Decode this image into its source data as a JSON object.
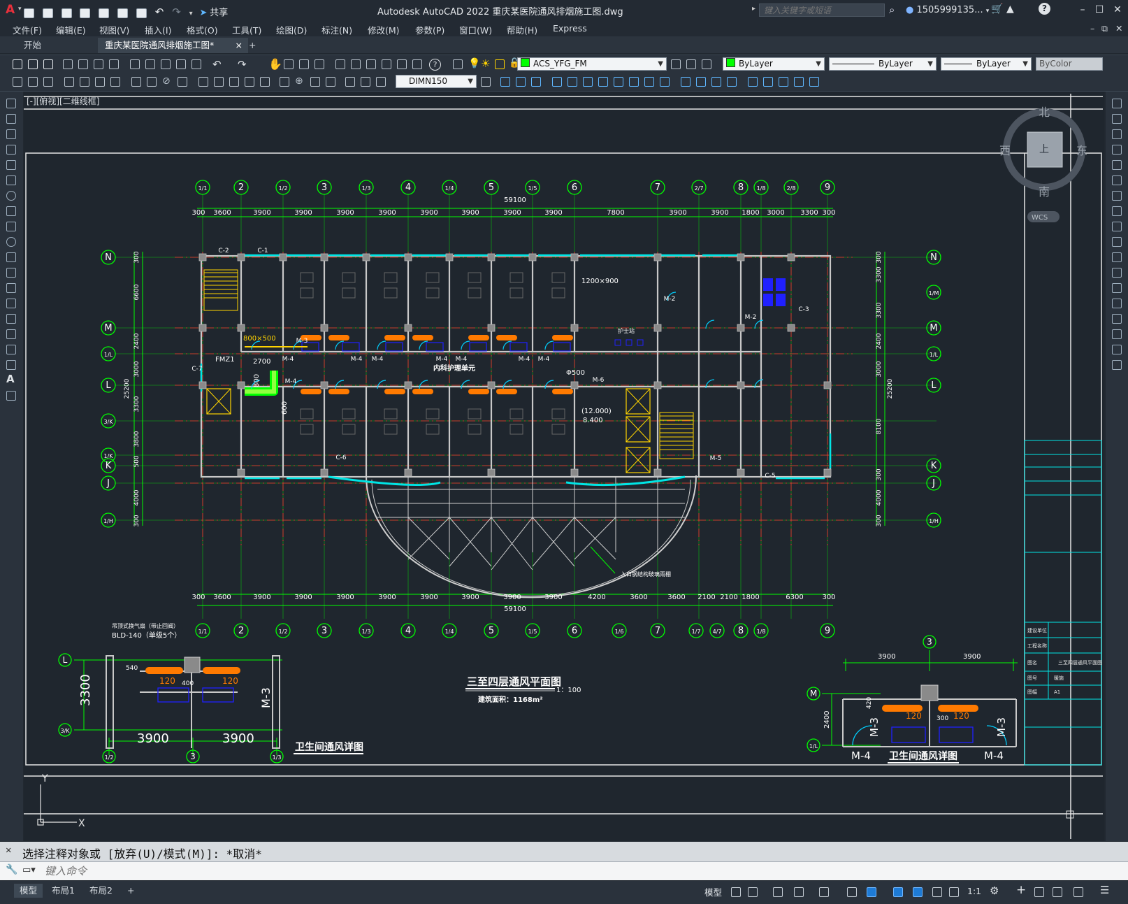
{
  "app": {
    "title": "Autodesk AutoCAD 2022    重庆某医院通风排烟施工图.dwg",
    "logo": "A",
    "share": "共享",
    "search_placeholder": "键入关键字或短语",
    "user": "1505999135...",
    "help": "?"
  },
  "menu": [
    "文件(F)",
    "编辑(E)",
    "视图(V)",
    "插入(I)",
    "格式(O)",
    "工具(T)",
    "绘图(D)",
    "标注(N)",
    "修改(M)",
    "参数(P)",
    "窗口(W)",
    "帮助(H)",
    "Express"
  ],
  "tabs": {
    "start": "开始",
    "document": "重庆某医院通风排烟施工图*",
    "close": "×",
    "add": "+"
  },
  "toolbar": {
    "layer": "ACS_YFG_FM",
    "color": "ByLayer",
    "linetype": "ByLayer",
    "lineweight": "ByLayer",
    "plotstyle": "ByColor",
    "dimstyle": "DIMN150"
  },
  "viewport_label": "[-][俯视][二维线框]",
  "viewcube": {
    "north": "北",
    "south": "南",
    "east": "东",
    "west": "西",
    "top": "上",
    "wcs": "WCS"
  },
  "drawing": {
    "plan_title": "三至四层通风平面图",
    "plan_scale": "1：100",
    "plan_area": "建筑面积：1168m²",
    "detail_title_left": "卫生间通风详图",
    "detail_title_right": "卫生间通风详图",
    "total_dim": "59100",
    "top_axes": [
      "1/1",
      "2",
      "1/2",
      "3",
      "1/3",
      "4",
      "1/4",
      "5",
      "1/5",
      "6",
      "7",
      "2/7",
      "8",
      "1/8",
      "2/8",
      "9"
    ],
    "bottom_axes": [
      "1/1",
      "2",
      "1/2",
      "3",
      "1/3",
      "4",
      "1/4",
      "5",
      "1/5",
      "6",
      "1/6",
      "7",
      "1/7",
      "4/7",
      "8",
      "1/8",
      "9"
    ],
    "left_axes": [
      "N",
      "M",
      "1/L",
      "L",
      "3/K",
      "1/K",
      "K",
      "J",
      "1/H"
    ],
    "right_axes": [
      "N",
      "1/M",
      "M",
      "1/L",
      "L",
      "K",
      "J",
      "1/H"
    ],
    "top_dims": [
      "300",
      "3600",
      "3900",
      "3900",
      "3900",
      "3900",
      "3900",
      "3900",
      "3900",
      "3900",
      "7800",
      "3900",
      "3900",
      "1800",
      "3000",
      "3300",
      "300"
    ],
    "bottom_dims": [
      "300",
      "3600",
      "3900",
      "3900",
      "3900",
      "3900",
      "3900",
      "3900",
      "3900",
      "3900",
      "4200",
      "3600",
      "3600",
      "2100",
      "2100",
      "1800",
      "6300",
      "300"
    ],
    "left_dims": [
      "300",
      "6600",
      "2400",
      "3000",
      "3300",
      "3800",
      "500",
      "4000",
      "300"
    ],
    "left_total": "25200",
    "right_dims": [
      "300",
      "3300",
      "3300",
      "2400",
      "3000",
      "8100",
      "300",
      "4000",
      "300"
    ],
    "right_total": "25200",
    "notes": {
      "duct_a": "1200×900",
      "duct_b": "800×500",
      "duct_c": "2700",
      "duct_d": "800",
      "duct_e": "600",
      "dia": "Φ500",
      "corridor": "内科护理单元",
      "elev1": "(12.000)",
      "elev2": "8.400",
      "fmz": "FMZ1",
      "fan": "吊顶式换气扇（带止回阀）",
      "fan_model": "BLD-140（单级5个）",
      "nurse": "护士站",
      "canopy": "入口钢结构玻璃雨棚"
    },
    "door_tags": [
      "M-4",
      "M-4",
      "M-4",
      "M-4",
      "M-4",
      "M-4",
      "M-4",
      "M-4",
      "M-2",
      "M-2",
      "M-3",
      "M-5",
      "M-6"
    ],
    "window_tags": [
      "C-1",
      "C-2",
      "C-3",
      "C-5",
      "C-6",
      "C-7"
    ],
    "detail_left": {
      "axis_top": "L",
      "axis_bottom": "3/K",
      "dim_v": "3300",
      "dim_a": "3900",
      "dim_b": "3900",
      "ax1": "1/2",
      "ax2": "3",
      "ax3": "1/3",
      "label_m3": "M-3",
      "d1": "540",
      "d2": "400",
      "c1": "120",
      "c2": "120"
    },
    "detail_right": {
      "axis": "3",
      "axis_top": "M",
      "axis_bottom": "1/L",
      "dim_v": "2400",
      "dim_a": "3900",
      "dim_b": "3900",
      "m3a": "M-3",
      "m3b": "M-3",
      "m4a": "M-4",
      "m4b": "M-4",
      "d1": "420",
      "d2": "300",
      "c1": "120",
      "c2": "120"
    }
  },
  "titleblock": {
    "rows": [
      "建设单位",
      "工程名称",
      "图名",
      "图号",
      "图幅"
    ],
    "drawing_name": "三至四层通风平面图",
    "number": "暖施",
    "sheet": "A1"
  },
  "ucs": {
    "x": "X",
    "y": "Y"
  },
  "command": {
    "history": "选择注释对象或 [放弃(U)/模式(M)]: *取消*",
    "placeholder": "键入命令"
  },
  "status": {
    "layouts": [
      "模型",
      "布局1",
      "布局2"
    ],
    "add": "+",
    "mode": "模型",
    "scale": "1:1"
  }
}
